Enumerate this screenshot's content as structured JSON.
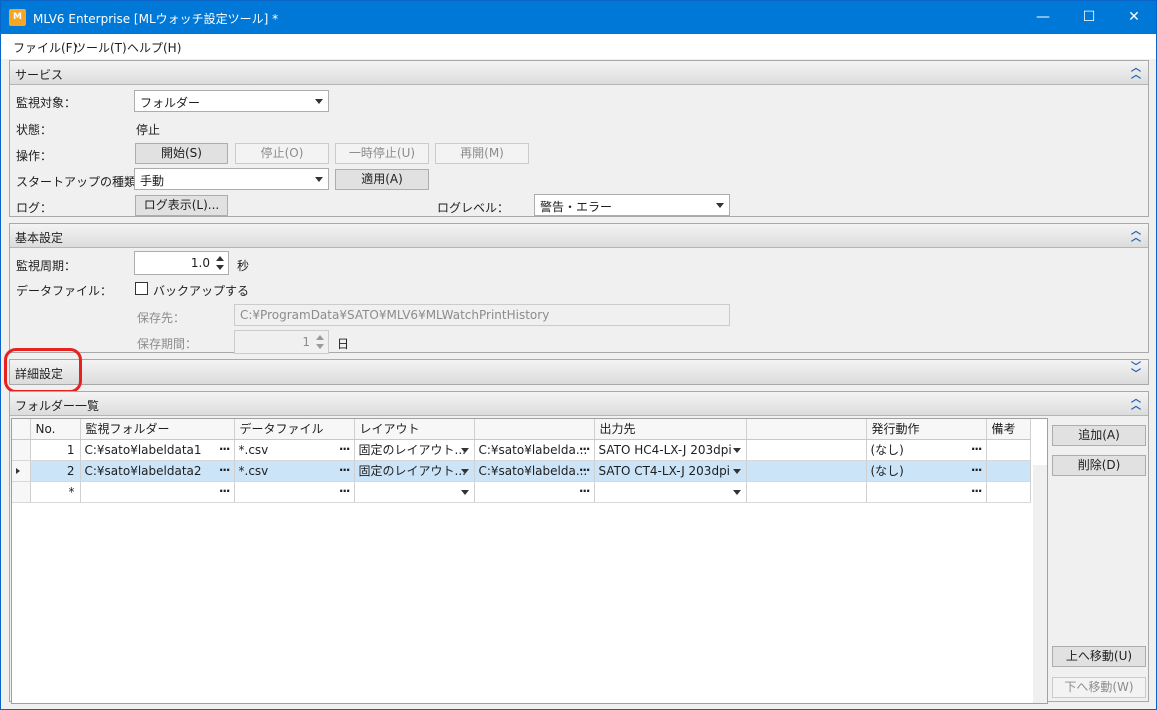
{
  "window": {
    "title": "MLV6 Enterprise [MLウォッチ設定ツール] *",
    "icon_text": "M",
    "minimize_glyph": "—",
    "maximize_glyph": "☐",
    "close_glyph": "✕"
  },
  "menu": [
    "ファイル(F)",
    "ツール(T)",
    "ヘルプ(H)"
  ],
  "service": {
    "title": "サービス",
    "target_label": "監視対象：",
    "target_value": "フォルダー",
    "status_label": "状態：",
    "status_value": "停止",
    "operation_label": "操作：",
    "buttons": {
      "start": "開始(S)",
      "stop": "停止(O)",
      "pause": "一時停止(U)",
      "resume": "再開(M)"
    },
    "startup_label": "スタートアップの種類：",
    "startup_value": "手動",
    "apply": "適用(A)",
    "log_label": "ログ：",
    "log_button": "ログ表示(L)...",
    "log_level_label": "ログレベル：",
    "log_level_value": "警告・エラー"
  },
  "basic": {
    "title": "基本設定",
    "period_label": "監視周期：",
    "period_value": "1.0",
    "period_unit": "秒",
    "datafile_label": "データファイル：",
    "backup_label": "バックアップする",
    "backup_checked": false,
    "save_to_label": "保存先：",
    "save_to_value": "C:¥ProgramData¥SATO¥MLV6¥MLWatchPrintHistory",
    "retention_label": "保存期間：",
    "retention_value": "1",
    "retention_unit": "日"
  },
  "advanced": {
    "title": "詳細設定"
  },
  "folder_list": {
    "title": "フォルダー一覧",
    "columns": [
      "No.",
      "監視フォルダー",
      "データファイル",
      "レイアウト",
      "",
      "出力先",
      "",
      "発行動作",
      "備考"
    ],
    "rows": [
      {
        "no": "1",
        "folder": "C:¥sato¥labeldata1",
        "datafile": "*.csv",
        "layout": "固定のレイアウト...",
        "layout_path": "C:¥sato¥labelda...",
        "output": "SATO HC4-LX-J 203dpi",
        "extra": "",
        "action": "(なし)",
        "note": "",
        "selected": false
      },
      {
        "no": "2",
        "folder": "C:¥sato¥labeldata2",
        "datafile": "*.csv",
        "layout": "固定のレイアウト...",
        "layout_path": "C:¥sato¥labelda...",
        "output": "SATO CT4-LX-J 203dpi",
        "extra": "",
        "action": "(なし)",
        "note": "",
        "selected": true
      }
    ],
    "new_row_marker": "*",
    "buttons": {
      "add": "追加(A)",
      "delete": "削除(D)",
      "move_up": "上へ移動(U)",
      "move_down": "下へ移動(W)"
    }
  }
}
